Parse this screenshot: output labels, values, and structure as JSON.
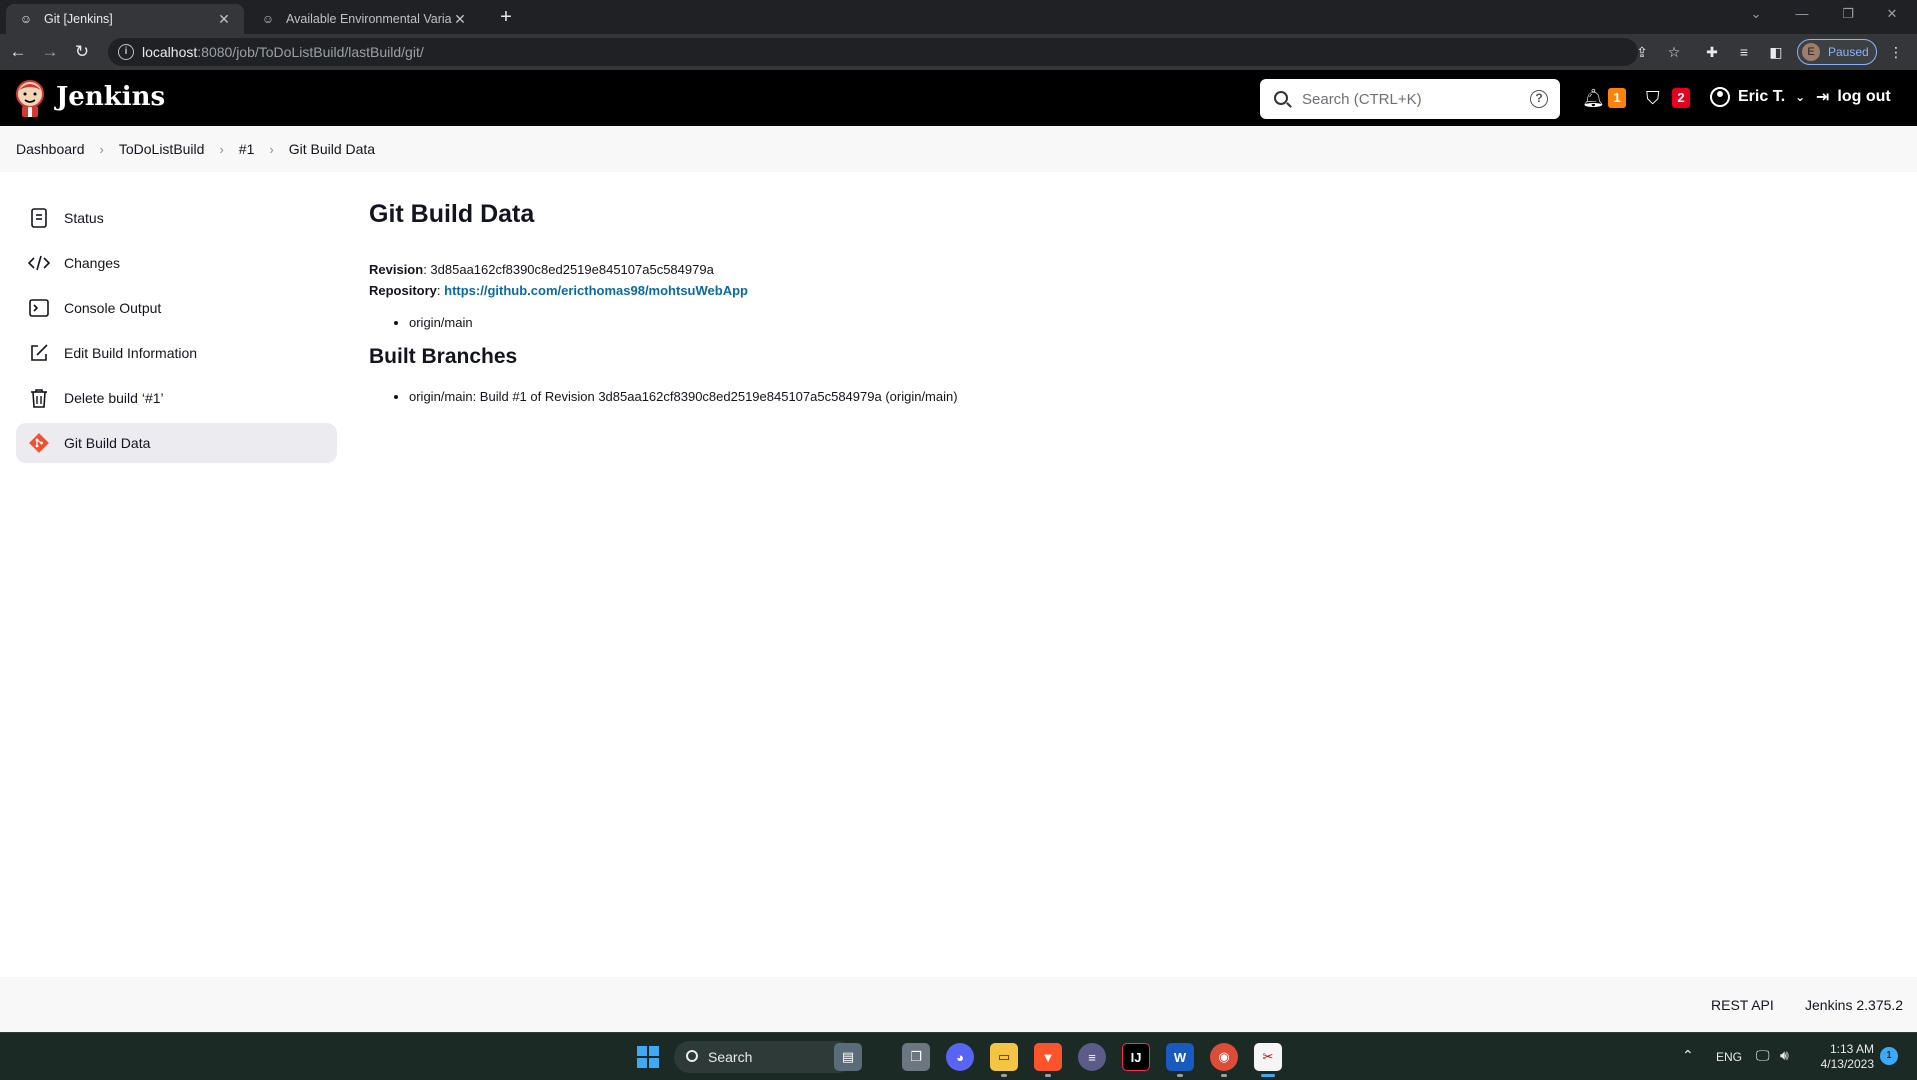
{
  "browser": {
    "tabs": [
      {
        "title": "Git [Jenkins]"
      },
      {
        "title": "Available Environmental Variables"
      }
    ],
    "url_host": "localhost",
    "url_path": ":8080/job/ToDoListBuild/lastBuild/git/",
    "profile_initial": "E",
    "profile_label": "Paused"
  },
  "header": {
    "brand": "Jenkins",
    "search_placeholder": "Search (CTRL+K)",
    "notifications_count": "1",
    "security_count": "2",
    "user_name": "Eric T.",
    "logout_label": "log out"
  },
  "breadcrumb": [
    "Dashboard",
    "ToDoListBuild",
    "#1",
    "Git Build Data"
  ],
  "sidebar": {
    "items": [
      {
        "label": "Status",
        "icon": "status-icon"
      },
      {
        "label": "Changes",
        "icon": "code-icon"
      },
      {
        "label": "Console Output",
        "icon": "terminal-icon"
      },
      {
        "label": "Edit Build Information",
        "icon": "edit-icon"
      },
      {
        "label": "Delete build ‘#1’",
        "icon": "trash-icon"
      },
      {
        "label": "Git Build Data",
        "icon": "git-icon"
      }
    ]
  },
  "main": {
    "title": "Git Build Data",
    "revision_label": "Revision",
    "revision_value": "3d85aa162cf8390c8ed2519e845107a5c584979a",
    "repository_label": "Repository",
    "repository_url": "https://github.com/ericthomas98/mohtsuWebApp",
    "branches": [
      "origin/main"
    ],
    "built_branches_title": "Built Branches",
    "built_branches": [
      "origin/main: Build #1 of Revision 3d85aa162cf8390c8ed2519e845107a5c584979a (origin/main)"
    ]
  },
  "footer": {
    "rest_api": "REST API",
    "version": "Jenkins 2.375.2"
  },
  "taskbar": {
    "search_label": "Search",
    "lang": "ENG",
    "time": "1:13 AM",
    "date": "4/13/2023",
    "notification_count": "1"
  },
  "colors": {
    "accent_link": "#0b6aa2",
    "badge_orange": "#fe820a",
    "badge_red": "#e6001f",
    "header_bg": "#000000"
  }
}
